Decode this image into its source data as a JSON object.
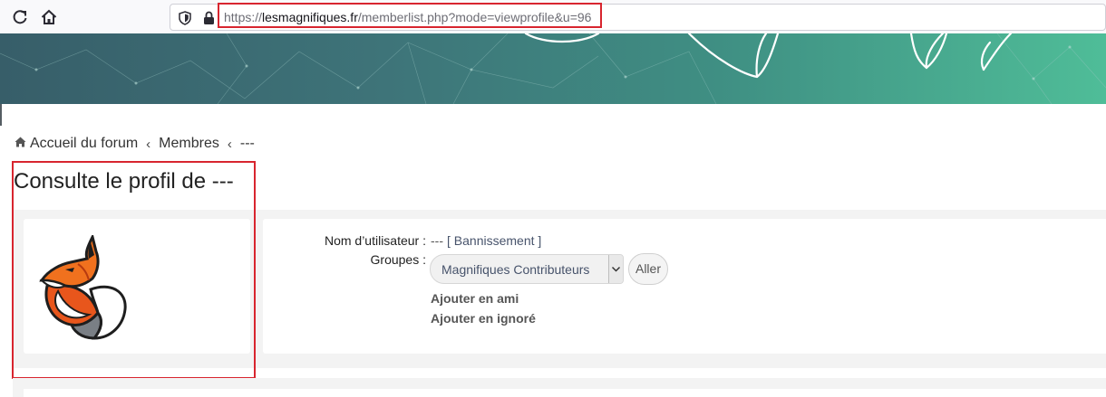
{
  "browser": {
    "url_scheme": "https://",
    "url_host": "lesmagnifiques.fr",
    "url_path": "/memberlist.php?mode=viewprofile&u=96",
    "icons": [
      "reload-icon",
      "home-icon",
      "shield-icon",
      "lock-icon"
    ]
  },
  "breadcrumb": {
    "home": "Accueil du forum",
    "separator": "‹",
    "members": "Membres",
    "current": "---"
  },
  "page": {
    "title": "Consulte le profil de ---"
  },
  "profile": {
    "avatar_icon": "fox-avatar",
    "username_label": "Nom d’utilisateur :",
    "username_value": "---",
    "ban_link": "[ Bannissement ]",
    "groups_label": "Groupes :",
    "groups_selected": "Magnifiques Contributeurs",
    "go_button": "Aller",
    "add_friend": "Ajouter en ami",
    "add_ignore": "Ajouter en ignoré"
  },
  "colors": {
    "highlight": "#d8252f",
    "banner_start": "#375e69",
    "banner_end": "#4fbd98",
    "link": "#47536b"
  }
}
